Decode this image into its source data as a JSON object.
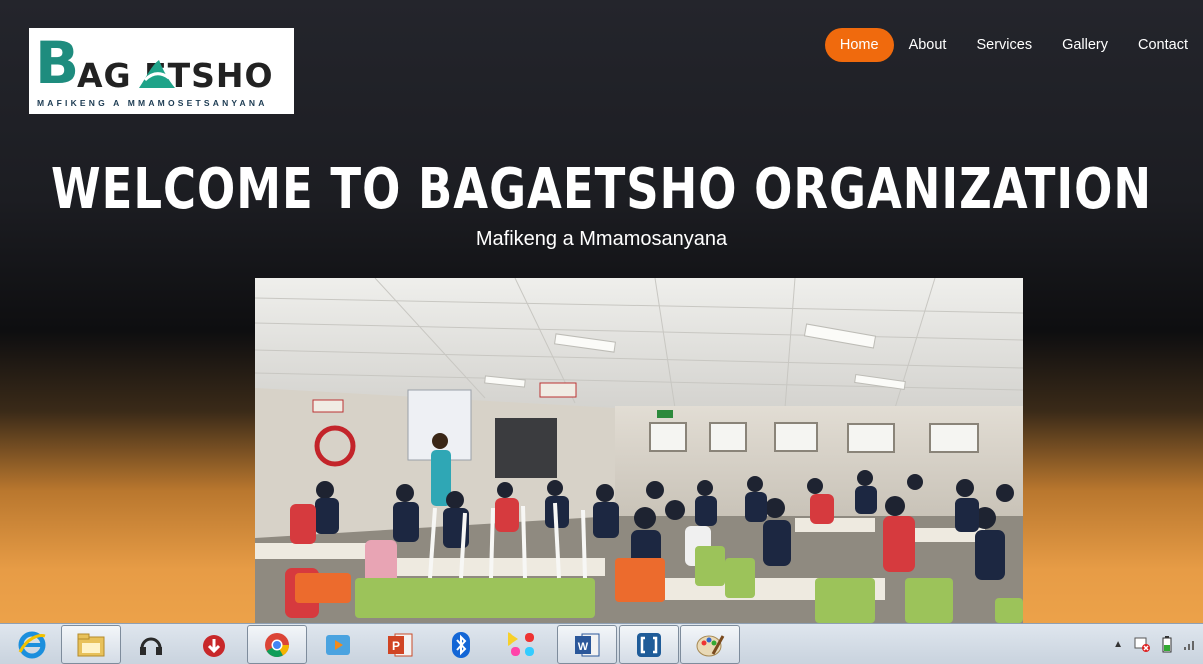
{
  "logo": {
    "mark": "B",
    "word": "AG  ETSHO",
    "tagline": "MAFIKENG A MMAMOSETSANYANA"
  },
  "nav": {
    "items": [
      {
        "label": "Home",
        "active": true
      },
      {
        "label": "About",
        "active": false
      },
      {
        "label": "Services",
        "active": false
      },
      {
        "label": "Gallery",
        "active": false
      },
      {
        "label": "Contact",
        "active": false
      }
    ],
    "active_color": "#f06a0d"
  },
  "hero": {
    "title": "WELCOME TO BAGAETSHO ORGANIZATION",
    "subtitle": "Mafikeng a Mmamosanyana"
  },
  "photo": {
    "sign_left": "← ○",
    "sign_right": "← ⌂",
    "exit_sign": "→"
  },
  "taskbar": {
    "apps": [
      "internet-explorer-icon",
      "file-explorer-icon",
      "headset-icon",
      "downloader-icon",
      "chrome-icon",
      "media-player-icon",
      "powerpoint-icon",
      "bluetooth-icon",
      "pacman-game-icon",
      "word-icon",
      "brackets-icon",
      "paint-icon"
    ]
  }
}
